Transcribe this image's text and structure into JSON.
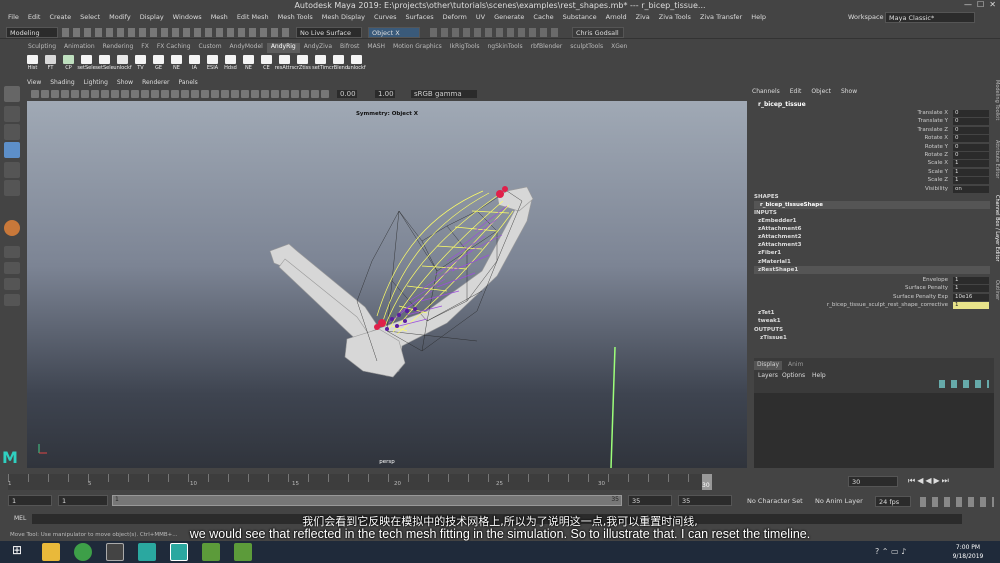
{
  "window": {
    "title": "Autodesk Maya 2019: E:\\projects\\other\\tutorials\\scenes\\examples\\rest_shapes.mb*   ---   r_bicep_tissue..."
  },
  "menubar": [
    "File",
    "Edit",
    "Create",
    "Select",
    "Modify",
    "Display",
    "Windows",
    "Mesh",
    "Edit Mesh",
    "Mesh Tools",
    "Mesh Display",
    "Curves",
    "Surfaces",
    "Deform",
    "UV",
    "Generate",
    "Cache",
    "Substance",
    "Arnold",
    "Ziva",
    "Ziva Tools",
    "Ziva Transfer",
    "Help"
  ],
  "workspace": {
    "label": "Workspace :",
    "value": "Maya Classic*"
  },
  "status": {
    "mode": "Modeling",
    "live_surface": "No Live Surface",
    "object_field": "Object X",
    "user": "Chris Godsall"
  },
  "shelf_tabs": [
    "Sculpting",
    "Animation",
    "Rendering",
    "FX",
    "FX Caching",
    "Custom",
    "AndyModel",
    "AndyRig",
    "AndyZiva",
    "Bifrost",
    "MASH",
    "Motion Graphics",
    "IkRigTools",
    "ngSkinTools",
    "rbfBlender",
    "sculptTools",
    "XGen"
  ],
  "shelf_active": "AndyRig",
  "shelf_icons": [
    "Hist",
    "FT",
    "CP",
    "setSele",
    "setSele",
    "unlockf",
    "TV",
    "GE",
    "NE",
    "IA",
    "ESIA",
    "Hdsd",
    "NE",
    "CE",
    "resAttrs",
    "crZtiss",
    "setTim",
    "crBlend",
    "unlockf"
  ],
  "viewport": {
    "menu": [
      "View",
      "Shading",
      "Lighting",
      "Show",
      "Renderer",
      "Panels"
    ],
    "exposure": "0.00",
    "gamma": "1.00",
    "color_space": "sRGB gamma",
    "heading": "Symmetry: Object X",
    "camera": "persp"
  },
  "channelbox": {
    "menu": [
      "Channels",
      "Edit",
      "Object",
      "Show"
    ],
    "object": "r_bicep_tissue",
    "attrs": [
      {
        "name": "Translate X",
        "value": "0"
      },
      {
        "name": "Translate Y",
        "value": "0"
      },
      {
        "name": "Translate Z",
        "value": "0"
      },
      {
        "name": "Rotate X",
        "value": "0"
      },
      {
        "name": "Rotate Y",
        "value": "0"
      },
      {
        "name": "Rotate Z",
        "value": "0"
      },
      {
        "name": "Scale X",
        "value": "1"
      },
      {
        "name": "Scale Y",
        "value": "1"
      },
      {
        "name": "Scale Z",
        "value": "1"
      },
      {
        "name": "Visibility",
        "value": "on"
      }
    ],
    "shapes_header": "SHAPES",
    "shape": "r_bicep_tissueShape",
    "inputs_header": "INPUTS",
    "inputs": [
      "zEmbedder1",
      "zAttachment6",
      "zAttachment2",
      "zAttachment3",
      "zFiber1",
      "zMaterial1",
      "zRestShape1"
    ],
    "rest_attrs": [
      {
        "name": "Envelope",
        "value": "1"
      },
      {
        "name": "Surface Penalty",
        "value": "1"
      },
      {
        "name": "Surface Penalty Exp",
        "value": "10e16"
      },
      {
        "name": "r_bicep_tissue_sculpt_rest_shape_corrective",
        "value": "1"
      }
    ],
    "post_inputs": [
      "zTet1",
      "tweak1"
    ],
    "outputs_header": "OUTPUTS",
    "outputs": [
      "zTissue1"
    ]
  },
  "layer_editor": {
    "tabs": [
      "Display",
      "Anim"
    ],
    "menu": [
      "Layers",
      "Options",
      "Help"
    ]
  },
  "side_tabs": [
    "Modeling Toolkit",
    "Attribute Editor",
    "Channel Box / Layer Editor",
    "Outliner"
  ],
  "timeline": {
    "ticks": [
      "1",
      "5",
      "10",
      "15",
      "20",
      "25",
      "30"
    ],
    "current": "30",
    "current_field": "30",
    "range_start": "1",
    "range_start2": "1",
    "range_slider_start": "1",
    "range_slider_end": "35",
    "range_end": "35",
    "range_end2": "35",
    "character_set": "No Character Set",
    "anim_layer": "No Anim Layer",
    "fps": "24 fps"
  },
  "cmdline": {
    "label": "MEL"
  },
  "helpline": "Move Tool: Use manipulator to move object(s). Ctrl+MMB+...",
  "subtitles": {
    "zh": "我们会看到它反映在模拟中的技术网格上,所以为了说明这一点,我可以重置时间线,",
    "en": "we would see that reflected in the tech mesh fitting in the simulation. So to illustrate that. I can reset the timeline."
  },
  "taskbar": {
    "time": "7:00 PM",
    "date": "9/18/2019"
  },
  "colors": {
    "selection": "#ffff66",
    "tet": "#8a3fc9",
    "attach": "#e0204a",
    "accent_green": "#6fd16f"
  }
}
